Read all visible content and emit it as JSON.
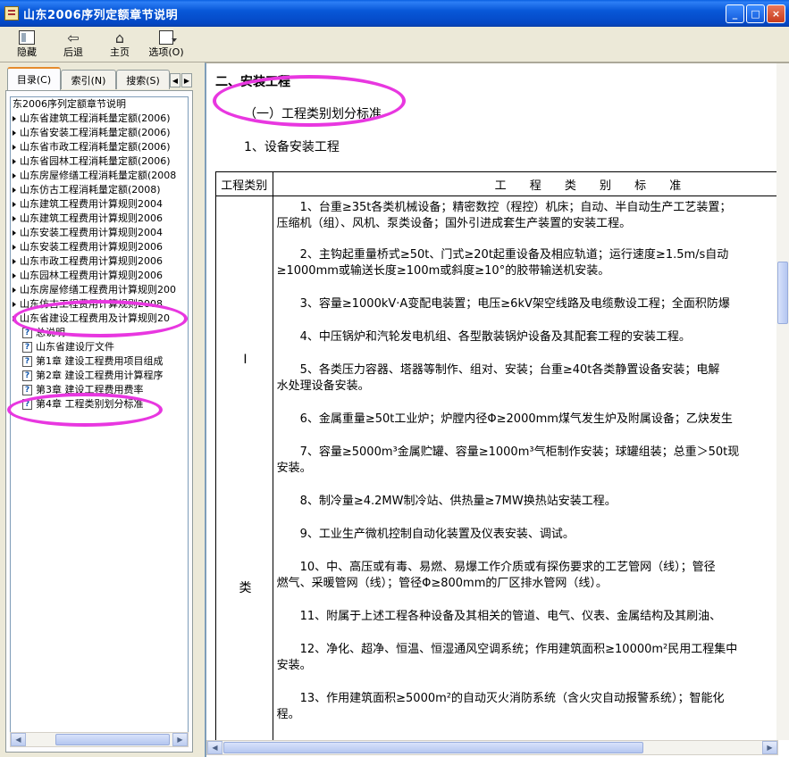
{
  "window": {
    "title": "山东2006序列定额章节说明",
    "min": "_",
    "max": "□",
    "close": "×"
  },
  "toolbar": {
    "hide": "隐藏",
    "back": "后退",
    "home": "主页",
    "options": "选项(O)"
  },
  "tabs": {
    "contents": "目录(C)",
    "index": "索引(N)",
    "search": "搜索(S)",
    "prev": "◀",
    "next": "▶"
  },
  "tree": {
    "root": "东2006序列定额章节说明",
    "items": [
      "山东省建筑工程消耗量定额(2006)",
      "山东省安装工程消耗量定额(2006)",
      "山东省市政工程消耗量定额(2006)",
      "山东省园林工程消耗量定额(2006)",
      "山东房屋修缮工程消耗量定额(2008",
      "山东仿古工程消耗量定额(2008)",
      "山东建筑工程费用计算规则2004",
      "山东建筑工程费用计算规则2006",
      "山东安装工程费用计算规则2004",
      "山东安装工程费用计算规则2006",
      "山东市政工程费用计算规则2006",
      "山东园林工程费用计算规则2006",
      "山东房屋修缮工程费用计算规则200",
      "山东仿古工程费用计算规则2008",
      "山东省建设工程费用及计算规则20"
    ],
    "children": [
      "总说明",
      "山东省建设厅文件",
      "第1章 建设工程费用项目组成",
      "第2章 建设工程费用计算程序",
      "第3章 建设工程费用费率",
      "第4章 工程类别划分标准"
    ]
  },
  "content": {
    "heading1": "二、安装工程",
    "heading2": "（一）工程类别划分标准",
    "heading3": "1、设备安装工程",
    "table": {
      "header_category": "工程类别",
      "header_standard": "工 程 类 别 标 准",
      "category_1": "Ⅰ",
      "category_2": "类",
      "paragraphs": [
        [
          "1、台重≥35t各类机械设备；精密数控（程控）机床；自动、半自动生产工艺装置；",
          "压缩机（组）、风机、泵类设备；国外引进成套生产装置的安装工程。"
        ],
        [
          "2、主钩起重量桥式≥50t、门式≥20t起重设备及相应轨道；运行速度≥1.5m/s自动",
          "≥1000mm或输送长度≥100m或斜度≥10°的胶带输送机安装。"
        ],
        [
          "3、容量≥1000kV·A变配电装置；电压≥6kV架空线路及电缆敷设工程；全面积防爆"
        ],
        [
          "4、中压锅炉和汽轮发电机组、各型散装锅炉设备及其配套工程的安装工程。"
        ],
        [
          "5、各类压力容器、塔器等制作、组对、安装；台重≥40t各类静置设备安装；电解",
          "水处理设备安装。"
        ],
        [
          "6、金属重量≥50t工业炉；炉膛内径Φ≥2000mm煤气发生炉及附属设备；乙炔发生"
        ],
        [
          "7、容量≥5000m³金属贮罐、容量≥1000m³气柜制作安装；球罐组装；总重＞50t现",
          "安装。"
        ],
        [
          "8、制冷量≥4.2MW制冷站、供热量≥7MW换热站安装工程。"
        ],
        [
          "9、工业生产微机控制自动化装置及仪表安装、调试。"
        ],
        [
          "10、中、高压或有毒、易燃、易爆工作介质或有探伤要求的工艺管网（线）；管径",
          "燃气、采暖管网（线）；管径Φ≥800mm的厂区排水管网（线）。"
        ],
        [
          "11、附属于上述工程各种设备及其相关的管道、电气、仪表、金属结构及其刷油、"
        ],
        [
          "12、净化、超净、恒温、恒湿通风空调系统；作用建筑面积≥10000m²民用工程集中",
          "安装。"
        ],
        [
          "13、作用建筑面积≥5000m²的自动灭火消防系统（含火灾自动报警系统）；智能化",
          "程。"
        ]
      ]
    }
  },
  "colors": {
    "highlight": "#e837e0",
    "titlebar": "#0858d8"
  }
}
